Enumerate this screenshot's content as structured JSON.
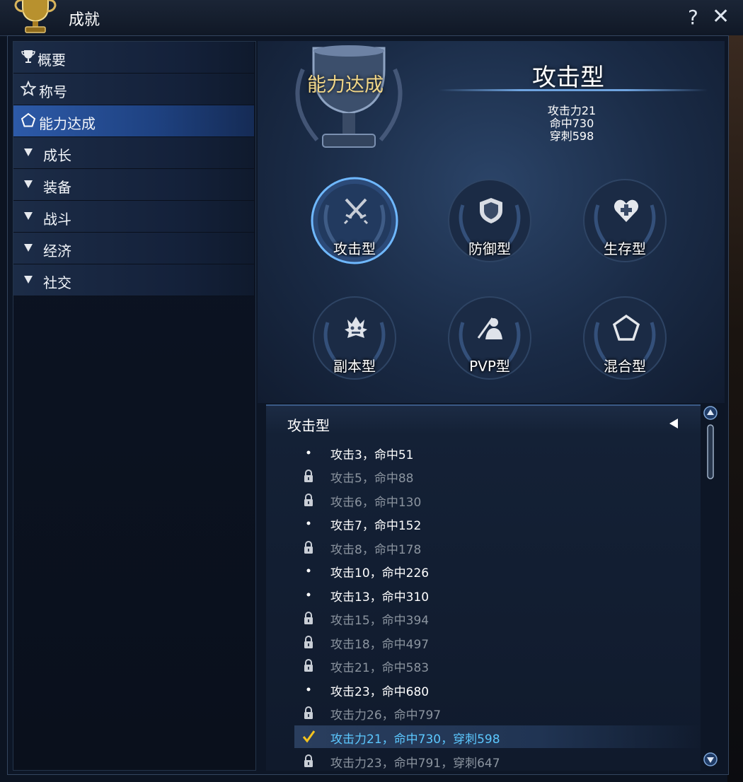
{
  "window": {
    "title": "成就",
    "help_label": "?",
    "close_label": "✕"
  },
  "sidebar": {
    "items": [
      {
        "label": "概要",
        "icon": "trophy-icon"
      },
      {
        "label": "称号",
        "icon": "star-icon"
      },
      {
        "label": "能力达成",
        "icon": "pentagon-icon"
      },
      {
        "label": "成长",
        "icon": "triangle-down-icon"
      },
      {
        "label": "装备",
        "icon": "triangle-down-icon"
      },
      {
        "label": "战斗",
        "icon": "triangle-down-icon"
      },
      {
        "label": "经济",
        "icon": "triangle-down-icon"
      },
      {
        "label": "社交",
        "icon": "triangle-down-icon"
      }
    ],
    "active_index": 2
  },
  "header": {
    "section_title": "能力达成",
    "type_title": "攻击型",
    "stats": [
      "攻击力21",
      "命中730",
      "穿刺598"
    ]
  },
  "categories": [
    {
      "label": "攻击型",
      "icon": "crossed-swords-icon",
      "selected": true
    },
    {
      "label": "防御型",
      "icon": "shield-icon",
      "selected": false
    },
    {
      "label": "生存型",
      "icon": "heart-plus-icon",
      "selected": false
    },
    {
      "label": "副本型",
      "icon": "monster-icon",
      "selected": false
    },
    {
      "label": "PVP型",
      "icon": "pvp-fighter-icon",
      "selected": false
    },
    {
      "label": "混合型",
      "icon": "pentagon-icon",
      "selected": false
    }
  ],
  "list": {
    "header": "攻击型",
    "rows": [
      {
        "text": "攻击3，命中51",
        "state": "unlocked"
      },
      {
        "text": "攻击5，命中88",
        "state": "locked"
      },
      {
        "text": "攻击6，命中130",
        "state": "locked"
      },
      {
        "text": "攻击7，命中152",
        "state": "unlocked"
      },
      {
        "text": "攻击8，命中178",
        "state": "locked"
      },
      {
        "text": "攻击10，命中226",
        "state": "unlocked"
      },
      {
        "text": "攻击13，命中310",
        "state": "unlocked"
      },
      {
        "text": "攻击15，命中394",
        "state": "locked"
      },
      {
        "text": "攻击18，命中497",
        "state": "locked"
      },
      {
        "text": "攻击21，命中583",
        "state": "locked"
      },
      {
        "text": "攻击23，命中680",
        "state": "unlocked"
      },
      {
        "text": "攻击力26，命中797",
        "state": "locked"
      },
      {
        "text": "攻击力21，命中730，穿刺598",
        "state": "selected"
      },
      {
        "text": "攻击力23，命中791，穿刺647",
        "state": "locked"
      }
    ]
  },
  "colors": {
    "accent_gold": "#f1d687",
    "selected_text": "#5cc8ff",
    "locked_text": "#8b949f",
    "active_nav": "#2d5aa8"
  }
}
